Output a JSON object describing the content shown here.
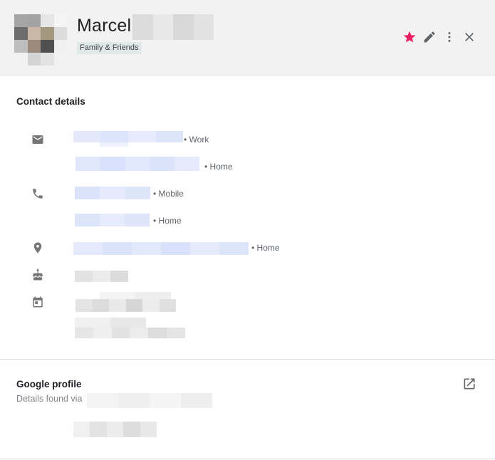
{
  "header": {
    "name": "Marcel",
    "label_chip": "Family & Friends",
    "star_color": "#e91e63",
    "icons": {
      "star": "star-icon",
      "edit": "pencil-icon",
      "more": "more-vertical-icon",
      "close": "close-icon"
    }
  },
  "contact_details": {
    "title": "Contact details",
    "emails": [
      {
        "type": "• Work"
      },
      {
        "type": "• Home"
      }
    ],
    "phones": [
      {
        "type": "• Mobile"
      },
      {
        "type": "• Home"
      }
    ],
    "address": {
      "type": "• Home"
    },
    "icons": {
      "email": "email-icon",
      "phone": "phone-icon",
      "address": "location-pin-icon",
      "birthday": "cake-icon",
      "event": "calendar-icon"
    }
  },
  "google_profile": {
    "title": "Google profile",
    "subtitle": "Details found via",
    "open_icon": "open-in-new-icon"
  }
}
